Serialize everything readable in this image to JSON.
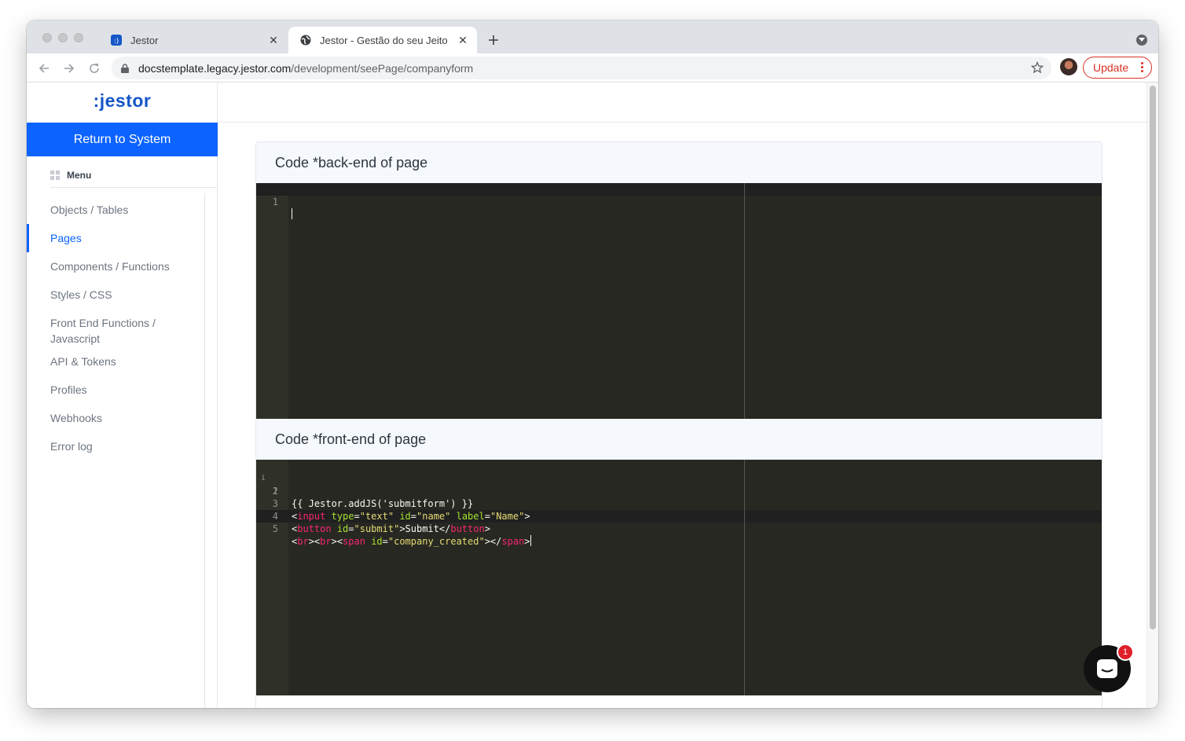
{
  "browser": {
    "tabs": [
      {
        "title": "Jestor",
        "favicon": "jestor-favicon"
      },
      {
        "title": "Jestor - Gestão do seu Jeito",
        "favicon": "globe-icon"
      }
    ],
    "url_host": "docstemplate.legacy.jestor.com",
    "url_path": "/development/seePage/companyform",
    "update_label": "Update"
  },
  "sidebar": {
    "logo": ":jestor",
    "return_label": "Return to System",
    "menu_title": "Menu",
    "items": [
      {
        "label": "Objects / Tables"
      },
      {
        "label": "Pages"
      },
      {
        "label": "Components / Functions"
      },
      {
        "label": "Styles / CSS"
      },
      {
        "label": "Front End Functions / Javascript"
      },
      {
        "label": "API & Tokens"
      },
      {
        "label": "Profiles"
      },
      {
        "label": "Webhooks"
      },
      {
        "label": "Error log"
      }
    ],
    "active_index": 1
  },
  "main": {
    "backend_title": "Code *back-end of page",
    "frontend_title": "Code *front-end of page",
    "backend_lines": [
      "1"
    ],
    "frontend": {
      "line_numbers": [
        "1",
        "2",
        "3",
        "4",
        "5"
      ],
      "code": [
        "{{ Jestor.addJS('submitform') }}",
        "",
        "<input type=\"text\" id=\"name\" label=\"Name\">",
        "<button id=\"submit\">Submit</button>",
        "<br><br><span id=\"company_created\"></span>"
      ]
    }
  },
  "chat": {
    "badge": "1"
  },
  "colors": {
    "accent": "#0c63ff",
    "logo": "#1456c8",
    "editor_bg": "#272822",
    "update": "#d93025"
  }
}
